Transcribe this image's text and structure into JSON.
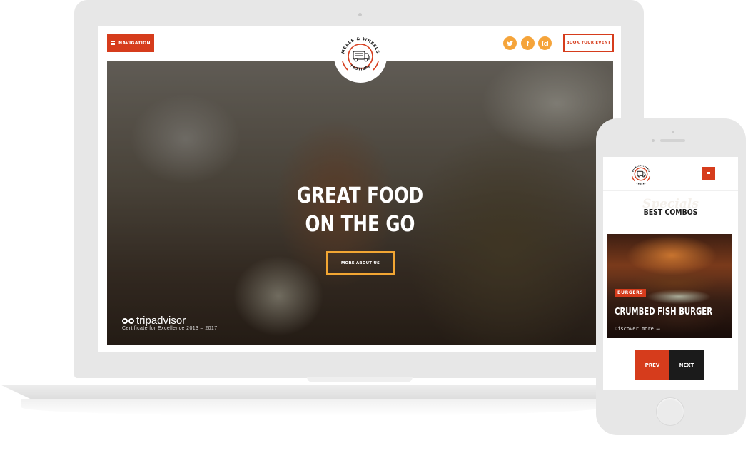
{
  "desktop": {
    "header": {
      "navigation_label": "NAVIGATION",
      "book_label": "BOOK YOUR EVENT",
      "logo": {
        "top_text": "MEALS & WHEELS",
        "bottom_text": "FESTIVAL",
        "icon": "food-truck-icon"
      },
      "social": [
        {
          "name": "twitter",
          "glyph": "🐦",
          "icon": "twitter-icon"
        },
        {
          "name": "facebook",
          "glyph": "f",
          "icon": "facebook-icon"
        },
        {
          "name": "instagram",
          "glyph": "",
          "icon": "instagram-icon"
        }
      ]
    },
    "hero": {
      "title_line1": "GREAT FOOD",
      "title_line2": "ON THE GO",
      "cta_label": "MORE ABOUT US",
      "tripadvisor_name": "tripadvisor",
      "tripadvisor_cert": "Certificate for Excellence 2013 – 2017"
    }
  },
  "mobile": {
    "watermark": "Specials",
    "section_title": "BEST COMBOS",
    "card": {
      "badge": "BURGERS",
      "title": "CRUMBED FISH BURGER",
      "link": "Discover more ⟶"
    },
    "prev_label": "PREV",
    "next_label": "NEXT"
  },
  "colors": {
    "brand_red": "#d63c1c",
    "accent_orange": "#f5a43a",
    "cta_border": "#f2a633",
    "dark": "#1b1b1b",
    "device": "#e7e7e7"
  }
}
